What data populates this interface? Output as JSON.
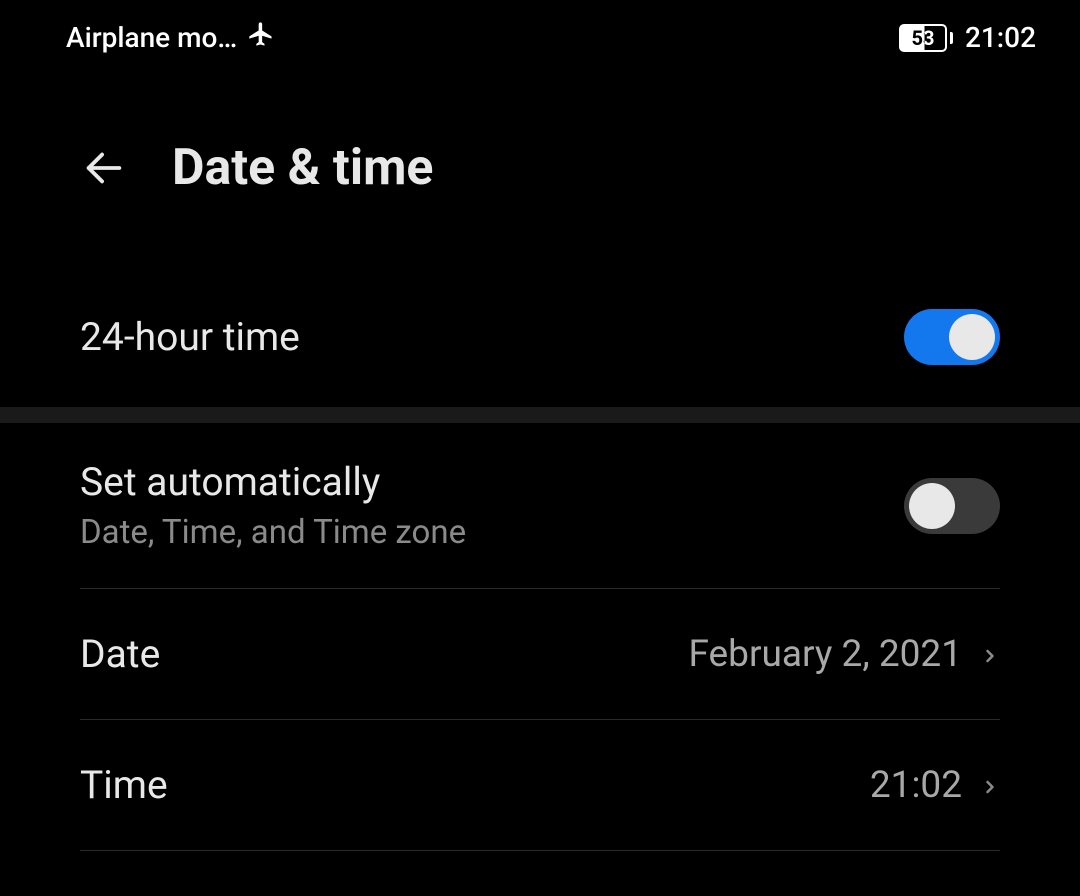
{
  "status_bar": {
    "airplane_label": "Airplane mo…",
    "battery_percent": "53",
    "clock": "21:02"
  },
  "header": {
    "title": "Date & time"
  },
  "settings": {
    "time_format": {
      "label": "24-hour time"
    },
    "set_auto": {
      "label": "Set automatically",
      "sublabel": "Date, Time, and Time zone"
    },
    "date": {
      "label": "Date",
      "value": "February 2, 2021"
    },
    "time": {
      "label": "Time",
      "value": "21:02"
    }
  }
}
